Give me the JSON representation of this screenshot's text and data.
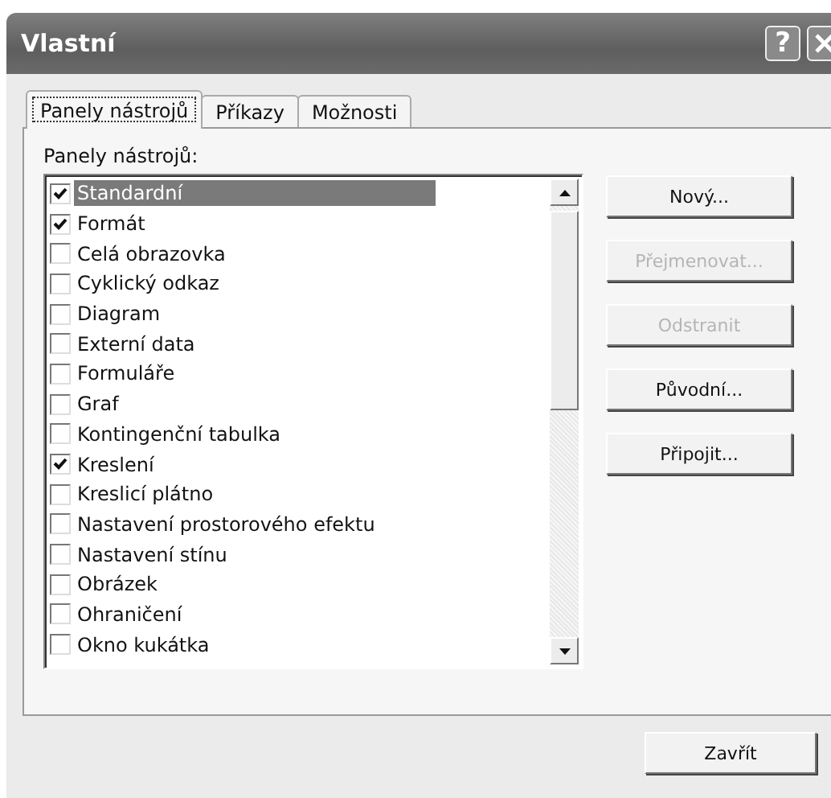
{
  "window": {
    "title": "Vlastní",
    "help_button": "?"
  },
  "tabs": [
    {
      "label": "Panely nástrojů",
      "selected": true
    },
    {
      "label": "Příkazy",
      "selected": false
    },
    {
      "label": "Možnosti",
      "selected": false
    }
  ],
  "toolbars_label": "Panely nástrojů:",
  "toolbars": [
    {
      "name": "Standardní",
      "checked": true,
      "selected": true
    },
    {
      "name": "Formát",
      "checked": true,
      "selected": false
    },
    {
      "name": "Celá obrazovka",
      "checked": false,
      "selected": false
    },
    {
      "name": "Cyklický odkaz",
      "checked": false,
      "selected": false
    },
    {
      "name": "Diagram",
      "checked": false,
      "selected": false
    },
    {
      "name": "Externí data",
      "checked": false,
      "selected": false
    },
    {
      "name": "Formuláře",
      "checked": false,
      "selected": false
    },
    {
      "name": "Graf",
      "checked": false,
      "selected": false
    },
    {
      "name": "Kontingenční tabulka",
      "checked": false,
      "selected": false
    },
    {
      "name": "Kreslení",
      "checked": true,
      "selected": false
    },
    {
      "name": "Kreslicí plátno",
      "checked": false,
      "selected": false
    },
    {
      "name": "Nastavení prostorového efektu",
      "checked": false,
      "selected": false
    },
    {
      "name": "Nastavení stínu",
      "checked": false,
      "selected": false
    },
    {
      "name": "Obrázek",
      "checked": false,
      "selected": false
    },
    {
      "name": "Ohraničení",
      "checked": false,
      "selected": false
    },
    {
      "name": "Okno kukátka",
      "checked": false,
      "selected": false
    }
  ],
  "side_buttons": [
    {
      "label": "Nový...",
      "disabled": false
    },
    {
      "label": "Přejmenovat...",
      "disabled": true
    },
    {
      "label": "Odstranit",
      "disabled": true
    },
    {
      "label": "Původní...",
      "disabled": false
    },
    {
      "label": "Připojit...",
      "disabled": false
    }
  ],
  "close_button": "Zavřít"
}
